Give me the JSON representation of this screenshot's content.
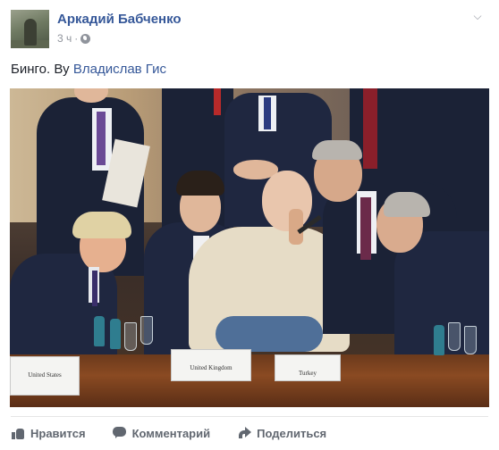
{
  "post": {
    "author": "Аркадий Бабченко",
    "time": "3 ч",
    "separator": "·",
    "text_prefix": "Бинго. Ву",
    "text_link": "Владислав Гис"
  },
  "photo": {
    "name_cards": [
      "United States",
      "United Kingdom",
      "Turkey"
    ]
  },
  "actions": {
    "like_label": "Нравится",
    "comment_label": "Комментарий",
    "share_label": "Поделиться"
  }
}
